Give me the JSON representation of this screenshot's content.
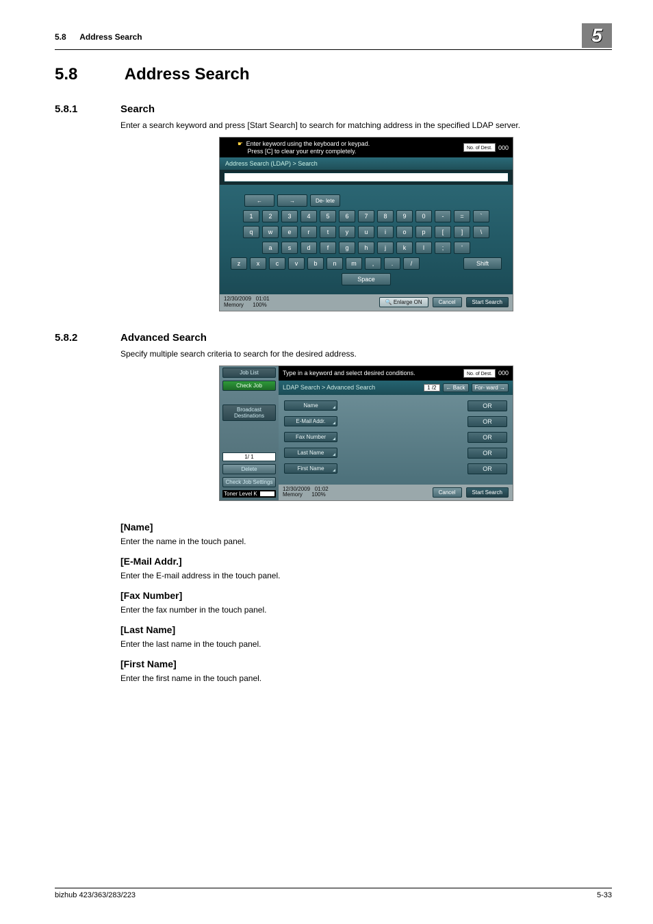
{
  "header": {
    "section_ref": "5.8",
    "section_title": "Address Search",
    "chapter_num": "5"
  },
  "h1": {
    "num": "5.8",
    "title": "Address Search"
  },
  "s1": {
    "num": "5.8.1",
    "title": "Search",
    "lead": "Enter a search keyword and press [Start Search] to search for matching address in the specified LDAP server.",
    "shot": {
      "hint1": "Enter keyword using the keyboard or keypad.",
      "hint2": "Press [C] to clear your entry completely.",
      "counter_label": "No. of Dest.",
      "counter_value": "000",
      "breadcrumb": "Address Search (LDAP) > Search",
      "input_value": "",
      "arrow_left": "←",
      "arrow_right": "→",
      "delete": "De- lete",
      "row_num": [
        "1",
        "2",
        "3",
        "4",
        "5",
        "6",
        "7",
        "8",
        "9",
        "0",
        "-",
        "=",
        "`"
      ],
      "row_q": [
        "q",
        "w",
        "e",
        "r",
        "t",
        "y",
        "u",
        "i",
        "o",
        "p",
        "[",
        "]",
        "\\"
      ],
      "row_a": [
        "a",
        "s",
        "d",
        "f",
        "g",
        "h",
        "j",
        "k",
        "l",
        ";",
        "'"
      ],
      "row_z": [
        "z",
        "x",
        "c",
        "v",
        "b",
        "n",
        "m",
        ",",
        ".",
        "/"
      ],
      "shift": "Shift",
      "space": "Space",
      "datetime_date": "12/30/2009",
      "datetime_time": "01:01",
      "memory": "Memory",
      "memory_pct": "100%",
      "enlarge": "Enlarge ON",
      "cancel": "Cancel",
      "start": "Start Search"
    }
  },
  "s2": {
    "num": "5.8.2",
    "title": "Advanced Search",
    "lead": "Specify multiple search criteria to search for the desired address.",
    "shot": {
      "job_list": "Job List",
      "check_job": "Check Job",
      "broadcast": "Broadcast Destinations",
      "page_small": "1/  1",
      "delete": "Delete",
      "check_settings": "Check Job Settings",
      "toner": "Toner Level",
      "toner_k": "K",
      "hint": "Type in a keyword and select desired conditions.",
      "counter_label": "No. of Dest.",
      "counter_value": "000",
      "breadcrumb": "LDAP Search > Advanced Search",
      "page": "1 /2",
      "back": "Back",
      "forward": "For- ward",
      "opts": {
        "name": "Name",
        "email": "E-Mail Addr.",
        "fax": "Fax Number",
        "last": "Last Name",
        "first": "First Name",
        "or": "OR"
      },
      "datetime_date": "12/30/2009",
      "datetime_time": "01:02",
      "memory": "Memory",
      "memory_pct": "100%",
      "cancel": "Cancel",
      "start": "Start Search"
    }
  },
  "fields": {
    "name_h": "[Name]",
    "name_d": "Enter the name in the touch panel.",
    "email_h": "[E-Mail Addr.]",
    "email_d": "Enter the E-mail address in the touch panel.",
    "fax_h": "[Fax Number]",
    "fax_d": "Enter the fax number in the touch panel.",
    "last_h": "[Last Name]",
    "last_d": "Enter the last name in the touch panel.",
    "first_h": "[First Name]",
    "first_d": "Enter the first name in the touch panel."
  },
  "footer": {
    "left": "bizhub 423/363/283/223",
    "right": "5-33"
  }
}
